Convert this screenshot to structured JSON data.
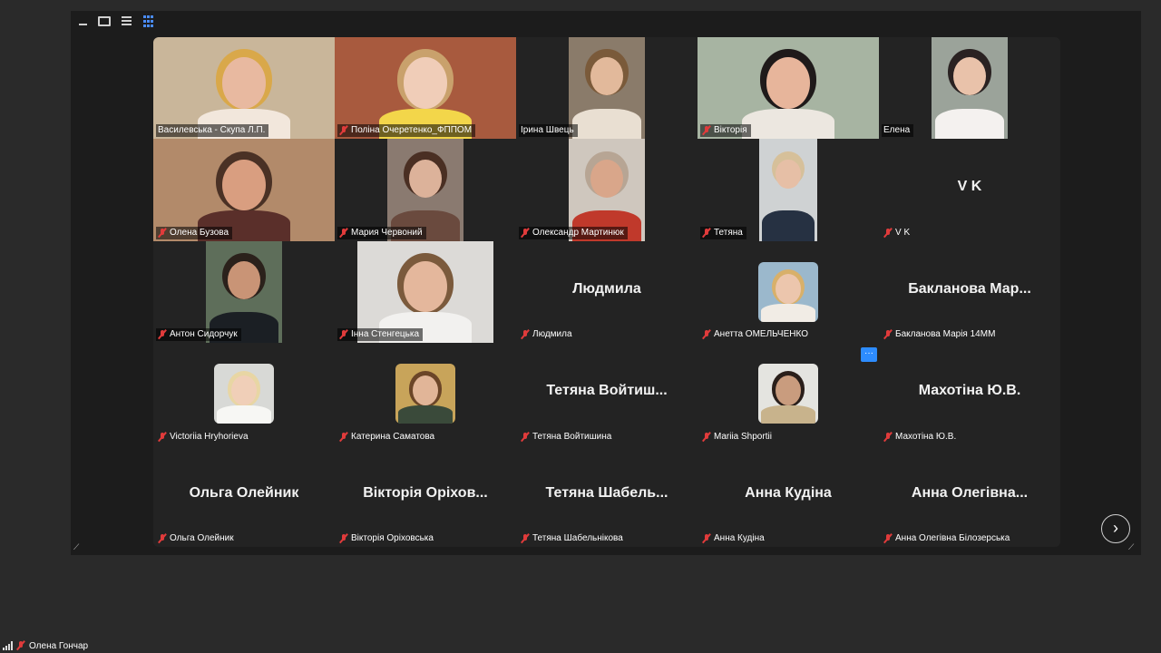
{
  "view_controls": [
    "minimize-icon",
    "speaker-view-icon",
    "strip-view-icon",
    "gallery-view-icon"
  ],
  "tiles": [
    {
      "label": "Василевська - Скупа Л.П.",
      "muted": false,
      "kind": "video",
      "bg": "#c9b69a",
      "skin": "#e8b9a0",
      "hair": "#d9a84a",
      "shirt": "#f2e7dc"
    },
    {
      "label": "Поліна Очеретенко_ФППОМ",
      "muted": true,
      "kind": "video",
      "bg": "#a85a3e",
      "skin": "#f0cdb8",
      "hair": "#c9a16c",
      "shirt": "#f3d64a"
    },
    {
      "label": "Ірина Швець",
      "muted": false,
      "kind": "video",
      "bg": "#8a7b6a",
      "skin": "#e2b99b",
      "hair": "#7a5a3a",
      "shirt": "#e9dfd2"
    },
    {
      "label": "Вікторія",
      "muted": true,
      "kind": "video",
      "bg": "#a7b4a2",
      "skin": "#e7b59b",
      "hair": "#1f1a1a",
      "shirt": "#ece7e0"
    },
    {
      "label": "Елена",
      "muted": false,
      "kind": "video",
      "bg": "#9ba39a",
      "skin": "#e9c2aa",
      "hair": "#2a2222",
      "shirt": "#f4f1ef"
    },
    {
      "label": "Олена Бузова",
      "muted": true,
      "kind": "video",
      "bg": "#b28a6a",
      "skin": "#d99e80",
      "hair": "#4a3125",
      "shirt": "#5a2f2a"
    },
    {
      "label": "Мария Червоний",
      "muted": true,
      "kind": "video",
      "bg": "#8a7a70",
      "skin": "#dcb29a",
      "hair": "#4a2f23",
      "shirt": "#6a4a3e"
    },
    {
      "label": "Олександр Мартинюк",
      "muted": true,
      "kind": "video",
      "bg": "#cfc7be",
      "skin": "#d9a68a",
      "hair": "#b7a594",
      "shirt": "#c0392b"
    },
    {
      "label": "Тетяна",
      "muted": true,
      "kind": "video",
      "bg": "#cfd2d3",
      "skin": "#e6bfa6",
      "hair": "#d6c09a",
      "shirt": "#263142"
    },
    {
      "label": "V K",
      "muted": true,
      "kind": "name",
      "big": "V K"
    },
    {
      "label": "Антон Сидорчук",
      "muted": true,
      "kind": "video",
      "bg": "#5e6e5a",
      "skin": "#c99476",
      "hair": "#2b211b",
      "shirt": "#1b1f24"
    },
    {
      "label": "Інна Стенгецька",
      "muted": true,
      "kind": "video",
      "bg": "#dcdad7",
      "skin": "#e4b79c",
      "hair": "#7b5a3c",
      "shirt": "#f2f1ef"
    },
    {
      "label": "Людмила",
      "muted": true,
      "kind": "name",
      "big": "Людмила"
    },
    {
      "label": "Анетта ОМЕЛЬЧЕНКО",
      "muted": true,
      "kind": "avatar",
      "bg": "#9bb8cc",
      "skin": "#ecc6ad",
      "hair": "#d8b06a",
      "shirt": "#f1ece5"
    },
    {
      "label": "Бакланова Марія 14ММ",
      "muted": true,
      "kind": "name",
      "big": "Бакланова Мар..."
    },
    {
      "label": "Victoriia Hryhorieva",
      "muted": true,
      "kind": "avatar",
      "bg": "#d8d9d6",
      "skin": "#f0cfb8",
      "hair": "#e8d6a4",
      "shirt": "#f7f7f4"
    },
    {
      "label": "Катерина Саматова",
      "muted": true,
      "kind": "avatar",
      "bg": "#c8a45a",
      "skin": "#e1b598",
      "hair": "#6b4528",
      "shirt": "#3a4a3a"
    },
    {
      "label": "Тетяна Войтишина",
      "muted": true,
      "kind": "name",
      "big": "Тетяна  Войтиш..."
    },
    {
      "label": "Mariia Shportii",
      "muted": true,
      "kind": "avatar",
      "bg": "#e4e4e0",
      "skin": "#c99c7e",
      "hair": "#2a1f1a",
      "shirt": "#c8b38c"
    },
    {
      "label": "Махотіна Ю.В.",
      "muted": true,
      "kind": "name",
      "big": "Махотіна Ю.В."
    },
    {
      "label": "Ольга Олейник",
      "muted": true,
      "kind": "name",
      "big": "Ольга Олейник"
    },
    {
      "label": "Вікторія Оріховська",
      "muted": true,
      "kind": "name",
      "big": "Вікторія Оріхов..."
    },
    {
      "label": "Тетяна Шабельнікова",
      "muted": true,
      "kind": "name",
      "big": "Тетяна  Шабель..."
    },
    {
      "label": "Анна Кудіна",
      "muted": true,
      "kind": "name",
      "big": "Анна Кудіна"
    },
    {
      "label": "Анна Олегівна Білозерська",
      "muted": true,
      "kind": "name",
      "big": "Анна  Олегівна..."
    }
  ],
  "more_button": "···",
  "next_page": "›",
  "self_view": {
    "label": "Олена Гончар",
    "muted": true
  }
}
